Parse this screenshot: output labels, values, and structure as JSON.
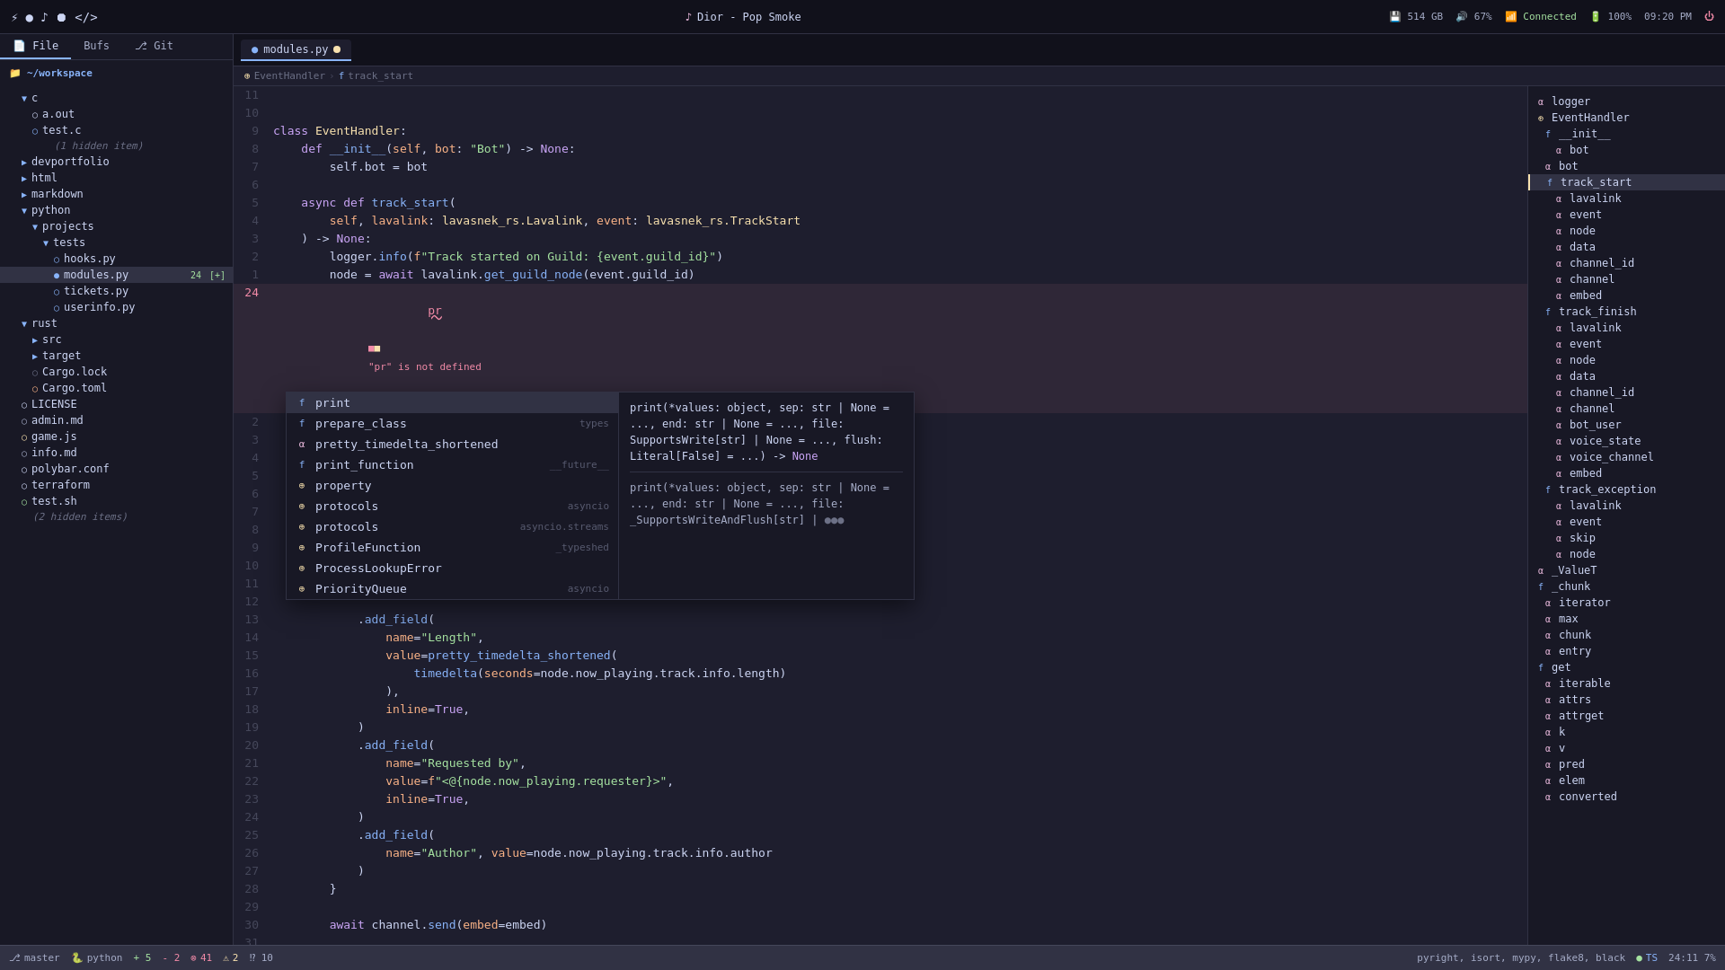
{
  "titlebar": {
    "left_icons": [
      "terminal-icon",
      "circle-icon",
      "music-icon",
      "record-icon",
      "code-icon"
    ],
    "center_text": "Dior - Pop Smoke",
    "right": {
      "storage": "514 GB",
      "volume": "67%",
      "network": "Connected",
      "battery": "100%",
      "time": "09:20 PM"
    }
  },
  "tabs": [
    {
      "label": "modules.py",
      "modified": true
    }
  ],
  "breadcrumb": [
    "EventHandler",
    ">",
    "track_start"
  ],
  "sidebar": {
    "tabs": [
      "File",
      "Bufs",
      "Git"
    ],
    "active_tab": "File",
    "root": "~/workspace",
    "items": [
      {
        "indent": 1,
        "type": "folder",
        "label": "c",
        "expanded": true
      },
      {
        "indent": 2,
        "type": "file",
        "label": "a.out"
      },
      {
        "indent": 2,
        "type": "file",
        "label": "test.c",
        "icon": "c"
      },
      {
        "indent": 2,
        "type": "hidden",
        "label": "(1 hidden item)"
      },
      {
        "indent": 1,
        "type": "folder",
        "label": "devportfolio"
      },
      {
        "indent": 1,
        "type": "folder",
        "label": "html"
      },
      {
        "indent": 1,
        "type": "folder",
        "label": "markdown"
      },
      {
        "indent": 1,
        "type": "folder",
        "label": "python",
        "expanded": true
      },
      {
        "indent": 2,
        "type": "folder",
        "label": "projects",
        "expanded": true
      },
      {
        "indent": 3,
        "type": "folder",
        "label": "tests",
        "expanded": true
      },
      {
        "indent": 4,
        "type": "file",
        "label": "hooks.py",
        "icon": "py"
      },
      {
        "indent": 4,
        "type": "file",
        "label": "modules.py",
        "icon": "py",
        "badge": "[+]",
        "error": true,
        "err_count": "24"
      },
      {
        "indent": 4,
        "type": "file",
        "label": "tickets.py",
        "icon": "py"
      },
      {
        "indent": 4,
        "type": "file",
        "label": "userinfo.py",
        "icon": "py"
      },
      {
        "indent": 1,
        "type": "folder",
        "label": "rust",
        "expanded": true
      },
      {
        "indent": 2,
        "type": "folder",
        "label": "src"
      },
      {
        "indent": 2,
        "type": "folder",
        "label": "target"
      },
      {
        "indent": 2,
        "type": "file",
        "label": "Cargo.lock",
        "icon": "lock"
      },
      {
        "indent": 2,
        "type": "file",
        "label": "Cargo.toml",
        "icon": "toml"
      },
      {
        "indent": 1,
        "type": "file",
        "label": "LICENSE"
      },
      {
        "indent": 1,
        "type": "file",
        "label": "admin.md",
        "icon": "md"
      },
      {
        "indent": 1,
        "type": "file",
        "label": "game.js",
        "icon": "js"
      },
      {
        "indent": 1,
        "type": "file",
        "label": "info.md",
        "icon": "md"
      },
      {
        "indent": 1,
        "type": "file",
        "label": "polybar.conf"
      },
      {
        "indent": 1,
        "type": "file",
        "label": "terraform"
      },
      {
        "indent": 1,
        "type": "file",
        "label": "test.sh",
        "icon": "sh"
      },
      {
        "indent": 1,
        "type": "hidden2",
        "label": "(2 hidden items)"
      }
    ]
  },
  "code_lines": [
    {
      "num": "11",
      "content": ""
    },
    {
      "num": "10",
      "content": ""
    },
    {
      "num": "9",
      "content": "class EventHandler:",
      "type": "normal"
    },
    {
      "num": "8",
      "content": "    def __init__(self, bot: \"Bot\") -> None:",
      "type": "normal"
    },
    {
      "num": "7",
      "content": "        self.bot = bot",
      "type": "normal"
    },
    {
      "num": "6",
      "content": ""
    },
    {
      "num": "5",
      "content": "    async def track_start(",
      "type": "normal"
    },
    {
      "num": "4",
      "content": "        self, lavalink: lavasnek_rs.Lavalink, event: lavasnek_rs.TrackStart",
      "type": "normal"
    },
    {
      "num": "3",
      "content": "    ) -> None:",
      "type": "normal"
    },
    {
      "num": "2",
      "content": "        logger.info(f\"Track started on Guild: {event.guild_id}\")",
      "type": "normal"
    },
    {
      "num": "1",
      "content": "        node = await lavalink.get_guild_node(event.guild_id)",
      "type": "normal"
    },
    {
      "num": "24",
      "content": "        pr",
      "type": "error"
    }
  ],
  "error_inline": "\"pr\" is not defined",
  "lower_code_lines": [
    {
      "num": "2",
      "content": ""
    },
    {
      "num": "3",
      "content": ""
    },
    {
      "num": "4",
      "content": ""
    },
    {
      "num": "5",
      "content": ""
    },
    {
      "num": "6",
      "content": ""
    },
    {
      "num": "7",
      "content": ""
    },
    {
      "num": "8",
      "content": ""
    },
    {
      "num": "9",
      "content": ""
    },
    {
      "num": "10",
      "content": ""
    },
    {
      "num": "11",
      "content": ""
    },
    {
      "num": "12",
      "content": ""
    },
    {
      "num": "13",
      "content": "            .add_field("
    },
    {
      "num": "14",
      "content": "                name=\"Length\","
    },
    {
      "num": "15",
      "content": "                value=pretty_timedelta_shortened("
    },
    {
      "num": "16",
      "content": "                    timedelta(seconds=node.now_playing.track.info.length)"
    },
    {
      "num": "17",
      "content": "                ),"
    },
    {
      "num": "18",
      "content": "                inline=True,"
    },
    {
      "num": "19",
      "content": "            )"
    },
    {
      "num": "20",
      "content": "            .add_field("
    },
    {
      "num": "21",
      "content": "                name=\"Requested by\","
    },
    {
      "num": "22",
      "content": "                value=f\"<@{node.now_playing.requester}>\","
    },
    {
      "num": "23",
      "content": "                inline=True,"
    },
    {
      "num": "24",
      "content": "            )"
    },
    {
      "num": "25",
      "content": "            .add_field("
    },
    {
      "num": "26",
      "content": "                name=\"Author\", value=node.now_playing.track.info.author"
    },
    {
      "num": "27",
      "content": "            )"
    },
    {
      "num": "28",
      "content": "        }"
    },
    {
      "num": "29",
      "content": ""
    },
    {
      "num": "30",
      "content": "        await channel.send(embed=embed)"
    },
    {
      "num": "31",
      "content": ""
    }
  ],
  "autocomplete": {
    "items": [
      {
        "type": "fn",
        "icon": "f",
        "label": "print",
        "source": "",
        "selected": true
      },
      {
        "type": "fn",
        "icon": "f",
        "label": "prepare_class",
        "source": "types"
      },
      {
        "type": "var",
        "icon": "α",
        "label": "pretty_timedelta_shortened",
        "source": ""
      },
      {
        "type": "fn",
        "icon": "f",
        "label": "print_function",
        "source": "__future__"
      },
      {
        "type": "cls",
        "icon": "⊕",
        "label": "property",
        "source": ""
      },
      {
        "type": "cls",
        "icon": "⊕",
        "label": "protocols",
        "source": "asyncio"
      },
      {
        "type": "cls",
        "icon": "⊕",
        "label": "protocols",
        "source": "asyncio.streams"
      },
      {
        "type": "cls",
        "icon": "⊕",
        "label": "ProfileFunction",
        "source": "_typeshed"
      },
      {
        "type": "cls",
        "icon": "⊕",
        "label": "ProcessLookupError",
        "source": ""
      },
      {
        "type": "cls",
        "icon": "⊕",
        "label": "PriorityQueue",
        "source": "asyncio"
      }
    ],
    "detail": {
      "sig1": "print(*values: object, sep: str | None = ..., end: str | None = ..., file: SupportsWrite[str] | None = ..., flush: Literal[False] = ...) -> None",
      "sig2": "print(*values: object, sep: str | None = ..., end: str | None = ..., file: _SupportsWriteAndFlush[str] | ..."
    }
  },
  "outline": {
    "items": [
      {
        "indent": 0,
        "type": "var",
        "icon": "α",
        "label": "logger"
      },
      {
        "indent": 0,
        "type": "cls",
        "icon": "⊕",
        "label": "EventHandler"
      },
      {
        "indent": 1,
        "type": "fn",
        "icon": "f",
        "label": "__init__"
      },
      {
        "indent": 2,
        "type": "var",
        "icon": "α",
        "label": "bot"
      },
      {
        "indent": 1,
        "type": "fn",
        "icon": "α",
        "label": "bot"
      },
      {
        "indent": 1,
        "type": "fn",
        "icon": "f",
        "label": "track_start"
      },
      {
        "indent": 2,
        "type": "var",
        "icon": "α",
        "label": "lavalink"
      },
      {
        "indent": 2,
        "type": "var",
        "icon": "α",
        "label": "event"
      },
      {
        "indent": 2,
        "type": "var",
        "icon": "α",
        "label": "node"
      },
      {
        "indent": 2,
        "type": "var",
        "icon": "α",
        "label": "data"
      },
      {
        "indent": 2,
        "type": "var",
        "icon": "α",
        "label": "channel_id"
      },
      {
        "indent": 2,
        "type": "var",
        "icon": "α",
        "label": "channel"
      },
      {
        "indent": 2,
        "type": "var",
        "icon": "α",
        "label": "embed"
      },
      {
        "indent": 1,
        "type": "fn",
        "icon": "f",
        "label": "track_finish"
      },
      {
        "indent": 2,
        "type": "var",
        "icon": "α",
        "label": "lavalink"
      },
      {
        "indent": 2,
        "type": "var",
        "icon": "α",
        "label": "event"
      },
      {
        "indent": 2,
        "type": "var",
        "icon": "α",
        "label": "node"
      },
      {
        "indent": 2,
        "type": "var",
        "icon": "α",
        "label": "data"
      },
      {
        "indent": 2,
        "type": "var",
        "icon": "α",
        "label": "channel_id"
      },
      {
        "indent": 2,
        "type": "var",
        "icon": "α",
        "label": "channel"
      },
      {
        "indent": 2,
        "type": "var",
        "icon": "α",
        "label": "bot_user"
      },
      {
        "indent": 2,
        "type": "var",
        "icon": "α",
        "label": "voice_state"
      },
      {
        "indent": 2,
        "type": "var",
        "icon": "α",
        "label": "voice_channel"
      },
      {
        "indent": 2,
        "type": "var",
        "icon": "α",
        "label": "embed"
      },
      {
        "indent": 1,
        "type": "fn",
        "icon": "f",
        "label": "track_exception"
      },
      {
        "indent": 2,
        "type": "var",
        "icon": "α",
        "label": "lavalink"
      },
      {
        "indent": 2,
        "type": "var",
        "icon": "α",
        "label": "event"
      },
      {
        "indent": 2,
        "type": "var",
        "icon": "α",
        "label": "skip"
      },
      {
        "indent": 2,
        "type": "var",
        "icon": "α",
        "label": "node"
      },
      {
        "indent": 0,
        "type": "var",
        "icon": "α",
        "label": "_ValueT"
      },
      {
        "indent": 0,
        "type": "fn",
        "icon": "f",
        "label": "_chunk"
      },
      {
        "indent": 1,
        "type": "var",
        "icon": "α",
        "label": "iterator"
      },
      {
        "indent": 1,
        "type": "var",
        "icon": "α",
        "label": "max"
      },
      {
        "indent": 1,
        "type": "var",
        "icon": "α",
        "label": "chunk"
      },
      {
        "indent": 1,
        "type": "var",
        "icon": "α",
        "label": "entry"
      },
      {
        "indent": 0,
        "type": "fn",
        "icon": "f",
        "label": "get"
      },
      {
        "indent": 1,
        "type": "var",
        "icon": "α",
        "label": "iterable"
      },
      {
        "indent": 1,
        "type": "var",
        "icon": "α",
        "label": "attrs"
      },
      {
        "indent": 1,
        "type": "var",
        "icon": "α",
        "label": "attrget"
      },
      {
        "indent": 1,
        "type": "var",
        "icon": "α",
        "label": "k"
      },
      {
        "indent": 1,
        "type": "var",
        "icon": "α",
        "label": "v"
      },
      {
        "indent": 1,
        "type": "var",
        "icon": "α",
        "label": "pred"
      },
      {
        "indent": 1,
        "type": "var",
        "icon": "α",
        "label": "elem"
      },
      {
        "indent": 1,
        "type": "var",
        "icon": "α",
        "label": "converted"
      }
    ]
  },
  "statusbar": {
    "git_branch": "master",
    "language": "python",
    "errors": "41",
    "warnings": "2",
    "hints": "10",
    "add": "5",
    "del": "2",
    "linters": "pyright, isort, mypy, flake8, black",
    "ts": "TS",
    "position": "24:11 7%"
  }
}
